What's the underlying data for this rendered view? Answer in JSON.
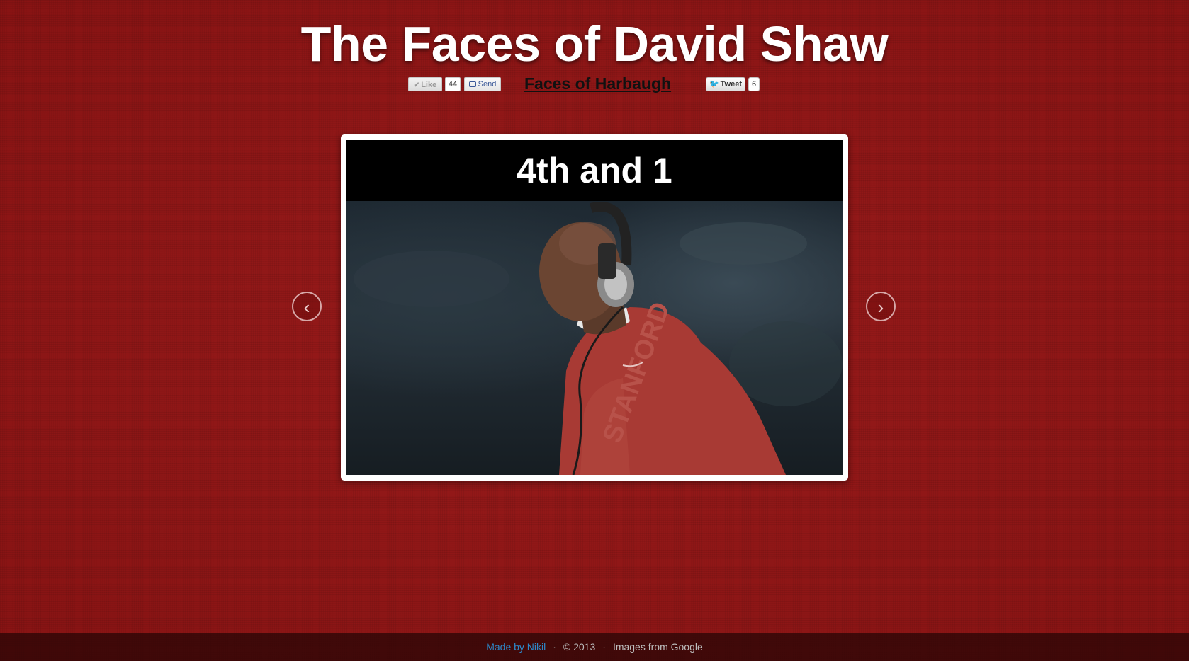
{
  "header": {
    "title": "The Faces of David Shaw"
  },
  "social": {
    "like_label": "Like",
    "like_count": "44",
    "send_label": "Send",
    "harbaugh_link": "Faces of Harbaugh",
    "tweet_label": "Tweet",
    "tweet_count": "6"
  },
  "slideshow": {
    "caption": "4th and 1",
    "prev_symbol": "‹",
    "next_symbol": "›",
    "photo_alt": "David Shaw in headset"
  },
  "footer": {
    "made_by": "Made by Nikil",
    "separator": "·",
    "copyright": "© 2013",
    "credit": "Images from Google"
  },
  "colors": {
    "background": "#8f1616",
    "footer_link": "#2d87c8",
    "caption_bg": "#000000"
  }
}
